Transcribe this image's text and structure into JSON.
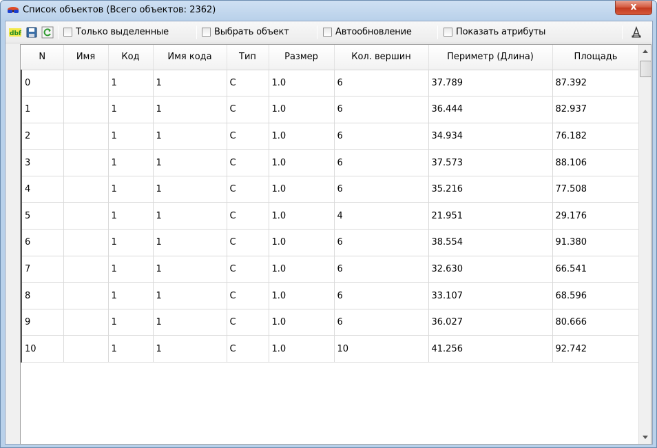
{
  "window": {
    "title": "Список объектов (Всего объектов: 2362)",
    "close_label": "x",
    "icon": "red-blue-glasses-icon"
  },
  "toolbar": {
    "dbf_label": "dbf",
    "save_icon": "save-icon",
    "refresh_icon": "refresh-icon",
    "checkboxes": [
      {
        "label": "Только выделенные",
        "checked": false
      },
      {
        "label": "Выбрать объект",
        "checked": false
      },
      {
        "label": "Автообновление",
        "checked": false
      },
      {
        "label": "Показать атрибуты",
        "checked": false
      }
    ],
    "font_icon": "font-icon"
  },
  "table": {
    "columns": [
      "N",
      "Имя",
      "Код",
      "Имя кода",
      "Тип",
      "Размер",
      "Кол. вершин",
      "Периметр (Длина)",
      "Площадь"
    ],
    "rows": [
      [
        "0",
        "",
        "1",
        "1",
        "C",
        "1.0",
        "6",
        "37.789",
        "87.392"
      ],
      [
        "1",
        "",
        "1",
        "1",
        "C",
        "1.0",
        "6",
        "36.444",
        "82.937"
      ],
      [
        "2",
        "",
        "1",
        "1",
        "C",
        "1.0",
        "6",
        "34.934",
        "76.182"
      ],
      [
        "3",
        "",
        "1",
        "1",
        "C",
        "1.0",
        "6",
        "37.573",
        "88.106"
      ],
      [
        "4",
        "",
        "1",
        "1",
        "C",
        "1.0",
        "6",
        "35.216",
        "77.508"
      ],
      [
        "5",
        "",
        "1",
        "1",
        "C",
        "1.0",
        "4",
        "21.951",
        "29.176"
      ],
      [
        "6",
        "",
        "1",
        "1",
        "C",
        "1.0",
        "6",
        "38.554",
        "91.380"
      ],
      [
        "7",
        "",
        "1",
        "1",
        "C",
        "1.0",
        "6",
        "32.630",
        "66.541"
      ],
      [
        "8",
        "",
        "1",
        "1",
        "C",
        "1.0",
        "6",
        "33.107",
        "68.596"
      ],
      [
        "9",
        "",
        "1",
        "1",
        "C",
        "1.0",
        "6",
        "36.027",
        "80.666"
      ],
      [
        "10",
        "",
        "1",
        "1",
        "C",
        "1.0",
        "10",
        "41.256",
        "92.742"
      ]
    ]
  }
}
